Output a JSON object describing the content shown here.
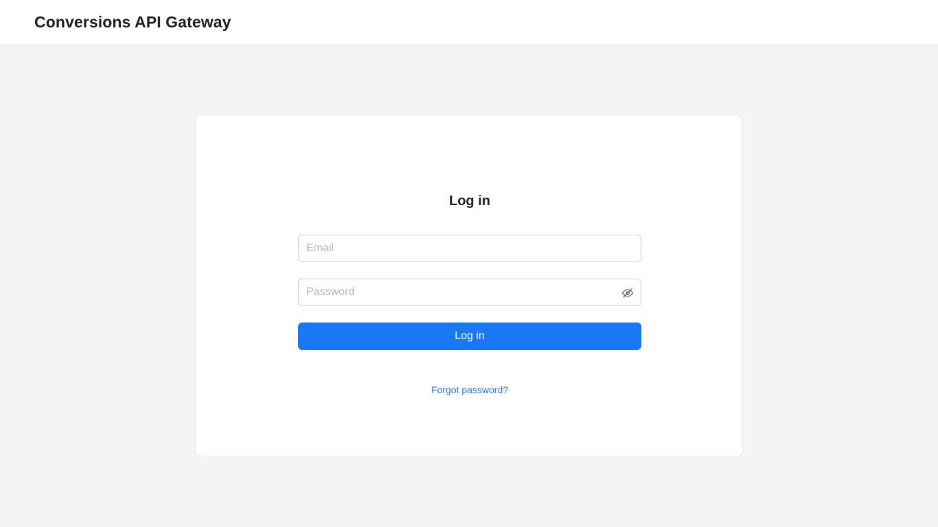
{
  "header": {
    "title": "Conversions API Gateway"
  },
  "login": {
    "heading": "Log in",
    "email": {
      "placeholder": "Email",
      "value": ""
    },
    "password": {
      "placeholder": "Password",
      "value": "",
      "toggle_icon": "eye-slash-icon"
    },
    "submit_label": "Log in",
    "forgot_password_label": "Forgot password?"
  },
  "colors": {
    "accent": "#1877f2",
    "page_background": "#f4f4f4",
    "card_background": "#ffffff",
    "placeholder": "#b0b3b8"
  }
}
